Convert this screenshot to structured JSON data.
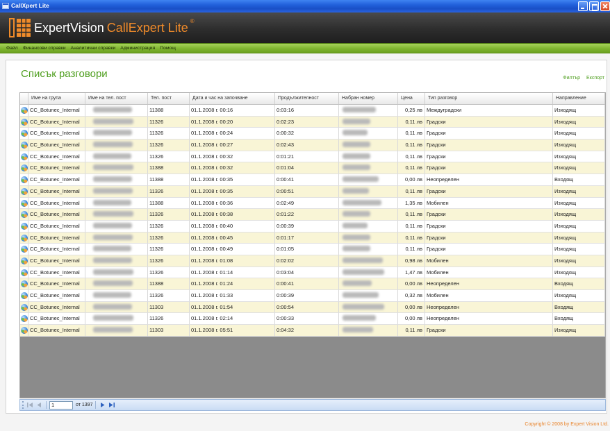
{
  "window": {
    "title": "CallXpert Lite"
  },
  "brand": {
    "primary": "ExpertVision",
    "product": "CallExpert Lite",
    "mark": "®"
  },
  "menu": [
    {
      "label": "Файл"
    },
    {
      "label": "Финансови справки"
    },
    {
      "label": "Аналитични справки"
    },
    {
      "label": "Администрация"
    },
    {
      "label": "Помощ"
    }
  ],
  "page": {
    "title": "Списък разговори",
    "filter_label": "Филтър",
    "export_label": "Експорт"
  },
  "table": {
    "columns": [
      "Име на група",
      "Име на тел. пост",
      "Тел. пост",
      "Дата и час на започване",
      "Продължителност",
      "Набран номер",
      "Цена",
      "Тип разговор",
      "Направление"
    ],
    "rows": [
      {
        "group": "CC_Botunec_Internal",
        "extension": "11388",
        "datetime": "01.1.2008 г. 00:16",
        "duration": "0:03:16",
        "price": "0,25 лв",
        "call_type": "Междуградски",
        "direction": "Изходящ"
      },
      {
        "group": "CC_Botunec_Internal",
        "extension": "11326",
        "datetime": "01.1.2008 г. 00:20",
        "duration": "0:02:23",
        "price": "0,11 лв",
        "call_type": "Градски",
        "direction": "Изходящ"
      },
      {
        "group": "CC_Botunec_Internal",
        "extension": "11326",
        "datetime": "01.1.2008 г. 00:24",
        "duration": "0:00:32",
        "price": "0,11 лв",
        "call_type": "Градски",
        "direction": "Изходящ"
      },
      {
        "group": "CC_Botunec_Internal",
        "extension": "11326",
        "datetime": "01.1.2008 г. 00:27",
        "duration": "0:02:43",
        "price": "0,11 лв",
        "call_type": "Градски",
        "direction": "Изходящ"
      },
      {
        "group": "CC_Botunec_Internal",
        "extension": "11326",
        "datetime": "01.1.2008 г. 00:32",
        "duration": "0:01:21",
        "price": "0,11 лв",
        "call_type": "Градски",
        "direction": "Изходящ"
      },
      {
        "group": "CC_Botunec_Internal",
        "extension": "11388",
        "datetime": "01.1.2008 г. 00:32",
        "duration": "0:01:04",
        "price": "0,11 лв",
        "call_type": "Градски",
        "direction": "Изходящ"
      },
      {
        "group": "CC_Botunec_Internal",
        "extension": "11388",
        "datetime": "01.1.2008 г. 00:35",
        "duration": "0:00:41",
        "price": "0,00 лв",
        "call_type": "Неопределен",
        "direction": "Входящ"
      },
      {
        "group": "CC_Botunec_Internal",
        "extension": "11326",
        "datetime": "01.1.2008 г. 00:35",
        "duration": "0:00:51",
        "price": "0,11 лв",
        "call_type": "Градски",
        "direction": "Изходящ"
      },
      {
        "group": "CC_Botunec_Internal",
        "extension": "11388",
        "datetime": "01.1.2008 г. 00:36",
        "duration": "0:02:49",
        "price": "1,35 лв",
        "call_type": "Мобилен",
        "direction": "Изходящ"
      },
      {
        "group": "CC_Botunec_Internal",
        "extension": "11326",
        "datetime": "01.1.2008 г. 00:38",
        "duration": "0:01:22",
        "price": "0,11 лв",
        "call_type": "Градски",
        "direction": "Изходящ"
      },
      {
        "group": "CC_Botunec_Internal",
        "extension": "11326",
        "datetime": "01.1.2008 г. 00:40",
        "duration": "0:00:39",
        "price": "0,11 лв",
        "call_type": "Градски",
        "direction": "Изходящ"
      },
      {
        "group": "CC_Botunec_Internal",
        "extension": "11326",
        "datetime": "01.1.2008 г. 00:45",
        "duration": "0:01:17",
        "price": "0,11 лв",
        "call_type": "Градски",
        "direction": "Изходящ"
      },
      {
        "group": "CC_Botunec_Internal",
        "extension": "11326",
        "datetime": "01.1.2008 г. 00:49",
        "duration": "0:01:05",
        "price": "0,11 лв",
        "call_type": "Градски",
        "direction": "Изходящ"
      },
      {
        "group": "CC_Botunec_Internal",
        "extension": "11326",
        "datetime": "01.1.2008 г. 01:08",
        "duration": "0:02:02",
        "price": "0,98 лв",
        "call_type": "Мобилен",
        "direction": "Изходящ"
      },
      {
        "group": "CC_Botunec_Internal",
        "extension": "11326",
        "datetime": "01.1.2008 г. 01:14",
        "duration": "0:03:04",
        "price": "1,47 лв",
        "call_type": "Мобилен",
        "direction": "Изходящ"
      },
      {
        "group": "CC_Botunec_Internal",
        "extension": "11388",
        "datetime": "01.1.2008 г. 01:24",
        "duration": "0:00:41",
        "price": "0,00 лв",
        "call_type": "Неопределен",
        "direction": "Входящ"
      },
      {
        "group": "CC_Botunec_Internal",
        "extension": "11326",
        "datetime": "01.1.2008 г. 01:33",
        "duration": "0:00:39",
        "price": "0,32 лв",
        "call_type": "Мобилен",
        "direction": "Изходящ"
      },
      {
        "group": "CC_Botunec_Internal",
        "extension": "11303",
        "datetime": "01.1.2008 г. 01:54",
        "duration": "0:00:54",
        "price": "0,00 лв",
        "call_type": "Неопределен",
        "direction": "Входящ"
      },
      {
        "group": "CC_Botunec_Internal",
        "extension": "11326",
        "datetime": "01.1.2008 г. 02:14",
        "duration": "0:00:33",
        "price": "0,00 лв",
        "call_type": "Неопределен",
        "direction": "Входящ"
      },
      {
        "group": "CC_Botunec_Internal",
        "extension": "11303",
        "datetime": "01.1.2008 г. 05:51",
        "duration": "0:04:32",
        "price": "0,11 лв",
        "call_type": "Градски",
        "direction": "Изходящ"
      }
    ]
  },
  "pager": {
    "current_page": "1",
    "total_label": "от 1397"
  },
  "footer": {
    "copyright": "Copyright © 2008 by Expert Vision Ltd."
  },
  "colors": {
    "accent_green": "#4e9e1e",
    "brand_orange": "#f08b2a",
    "row_alternate": "#f9f5d6",
    "empty_grid": "#8b8b8b"
  },
  "icons": {
    "row": "globe-icon",
    "pager": [
      "first-page-icon",
      "prev-page-icon",
      "next-page-icon",
      "last-page-icon"
    ],
    "window": [
      "minimize-icon",
      "maximize-icon",
      "close-icon"
    ]
  }
}
